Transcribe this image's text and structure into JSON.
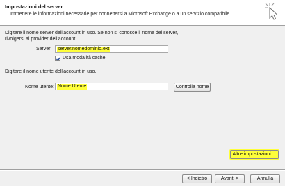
{
  "header": {
    "title": "Impostazioni del server",
    "subtitle": "Immettere le informazioni necessarie per connettersi a Microsoft Exchange o a un servizio compatibile."
  },
  "server_section": {
    "instructions_line1": "Digitare il nome server dell'account in uso. Se non si conosce il nome del server,",
    "instructions_line2": "rivolgersi al provider dell'account.",
    "server_label": "Server:",
    "server_value": "server.nomedominio.ext",
    "cache_label": "Usa modalità cache",
    "cache_checked": true
  },
  "user_section": {
    "instructions": "Digitare il nome utente dell'account in uso.",
    "username_label": "Nome utente:",
    "username_value": "Nome Utente",
    "check_name_button": "Controlla nome"
  },
  "more_settings_button": "Altre impostazioni ...",
  "footer": {
    "back_button": "< Indietro",
    "next_button": "Avanti >",
    "cancel_button": "Annulla"
  },
  "icons": {
    "header_cursor": "cursor-click-icon",
    "check": "checkmark-icon"
  },
  "colors": {
    "highlight": "#ffff3a",
    "header_bg": "#ffffff",
    "body_bg": "#f0f0f0"
  }
}
